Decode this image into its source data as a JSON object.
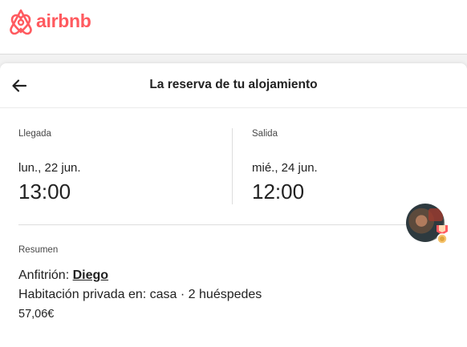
{
  "brand": {
    "name": "airbnb",
    "color": "#ff5a5f",
    "icon": "airbnb-belo-icon"
  },
  "header": {
    "title": "La reserva de tu alojamiento",
    "back_icon": "arrow-left-icon"
  },
  "checkin": {
    "label": "Llegada",
    "date": "lun., 22 jun.",
    "time": "13:00"
  },
  "checkout": {
    "label": "Salida",
    "date": "mié., 24 jun.",
    "time": "12:00"
  },
  "summary": {
    "label": "Resumen",
    "host_prefix": "Anfitrión:",
    "host_name": "Diego",
    "room": "Habitación privada en: casa · 2 huéspedes",
    "price": "57,06€"
  },
  "host": {
    "avatar": "host-avatar",
    "badge_icon": "superhost-badge-icon"
  }
}
